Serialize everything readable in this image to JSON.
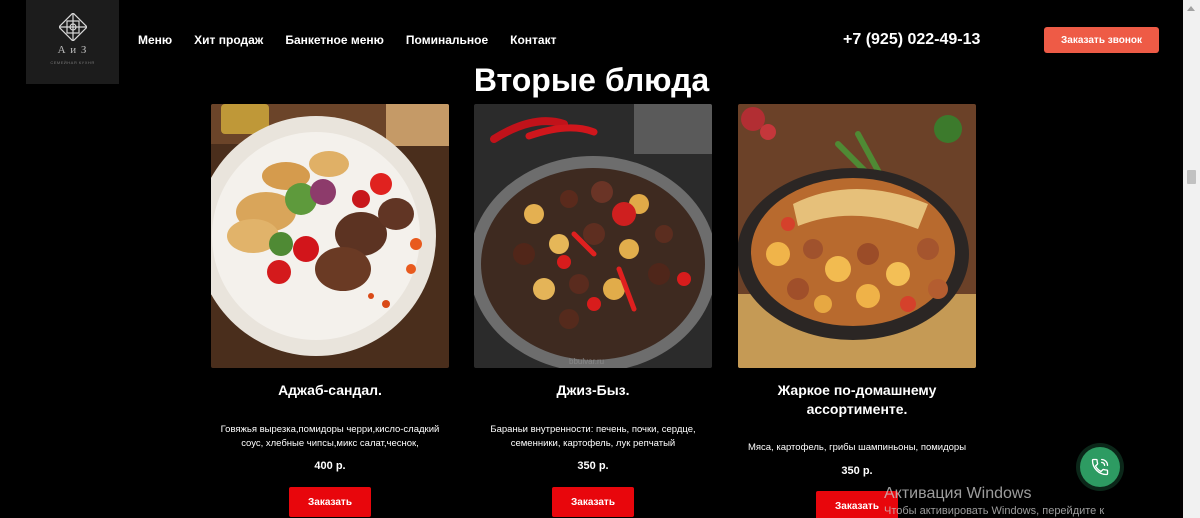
{
  "logo": {
    "text": "А и З",
    "subtext": "СЕМЕЙНАЯ КУХНЯ"
  },
  "nav": {
    "items": [
      {
        "label": "Меню"
      },
      {
        "label": "Хит продаж"
      },
      {
        "label": "Банкетное меню"
      },
      {
        "label": "Поминальное"
      },
      {
        "label": "Контакт"
      }
    ]
  },
  "header": {
    "phone": "+7 (925) 022-49-13",
    "callback_label": "Заказать звонок"
  },
  "section": {
    "title": "Вторые блюда"
  },
  "products": [
    {
      "name": "Аджаб-сандал.",
      "description": "Говяжья вырезка,помидоры черри,кисло-сладкий соус, хлебные чипсы,микс салат,чеснок,",
      "price": "400 р.",
      "button_label": "Заказать"
    },
    {
      "name": "Джиз-Быз.",
      "description": "Бараньи внутренности: печень, почки, сердце, семенники, картофель, лук репчатый",
      "price": "350 р.",
      "button_label": "Заказать",
      "photo_watermark": "bbulvar.ru"
    },
    {
      "name": "Жаркое по-домашнему ассортименте.",
      "description": "Мяса, картофель, грибы шампиньоны, помидоры",
      "price": "350 р.",
      "button_label": "Заказать"
    }
  ],
  "windows_watermark": {
    "title": "Активация Windows",
    "subtitle": "Чтобы активировать Windows, перейдите к"
  },
  "colors": {
    "background": "#000000",
    "callback_button": "#ee5b46",
    "order_button": "#e8060c",
    "phone_fab": "#2d9b62"
  },
  "icons": [
    "logo-emblem-icon",
    "phone-call-icon",
    "scroll-up-arrow-icon"
  ]
}
